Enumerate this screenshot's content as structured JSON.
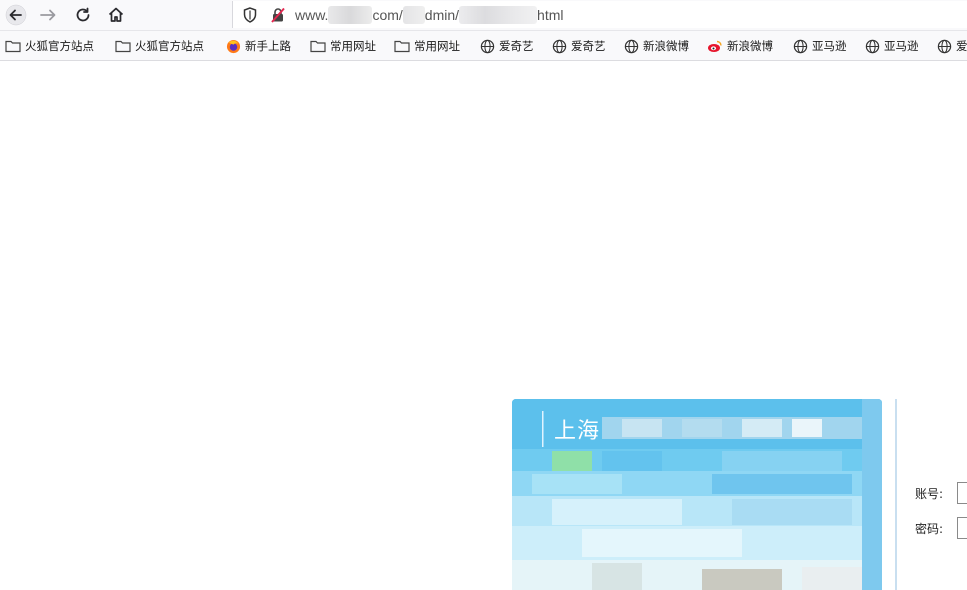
{
  "browser": {
    "url": {
      "prefix": "www.",
      "part2": "com/",
      "part3": "dmin/",
      "suffix": "html"
    }
  },
  "bookmarks": [
    {
      "label": "火狐官方站点",
      "icon": "folder-icon"
    },
    {
      "label": "火狐官方站点",
      "icon": "folder-icon"
    },
    {
      "label": "新手上路",
      "icon": "firefox-icon"
    },
    {
      "label": "常用网址",
      "icon": "folder-icon"
    },
    {
      "label": "常用网址",
      "icon": "folder-icon"
    },
    {
      "label": "爱奇艺",
      "icon": "globe-icon"
    },
    {
      "label": "爱奇艺",
      "icon": "globe-icon"
    },
    {
      "label": "新浪微博",
      "icon": "globe-icon"
    },
    {
      "label": "新浪微博",
      "icon": "weibo-icon"
    },
    {
      "label": "亚马逊",
      "icon": "globe-icon"
    },
    {
      "label": "亚马逊",
      "icon": "globe-icon"
    },
    {
      "label": "爱",
      "icon": "globe-icon"
    }
  ],
  "login": {
    "banner_title": "上海",
    "account_label": "账号:",
    "password_label": "密码:"
  },
  "colors": {
    "banner_top": "#3cb1e8",
    "banner_bottom": "#e8f6fb",
    "toolbar_bg": "#f9f9fb"
  }
}
